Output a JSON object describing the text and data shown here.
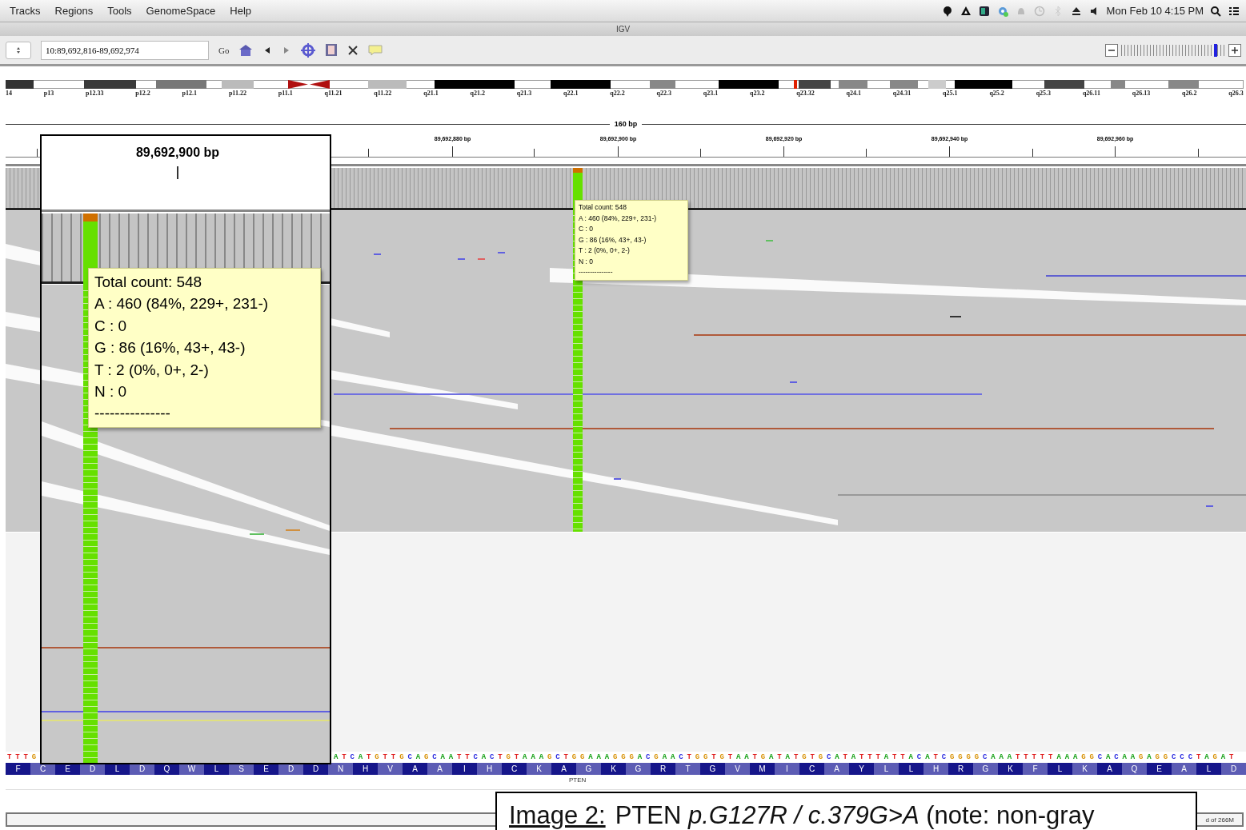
{
  "menu_bar": {
    "menus": [
      "Tracks",
      "Regions",
      "Tools",
      "GenomeSpace",
      "Help"
    ],
    "clock": "Mon Feb 10  4:15 PM"
  },
  "window": {
    "title": "IGV"
  },
  "toolbar": {
    "locus": "10:89,692,816-89,692,974",
    "go_button": "Go",
    "zoom": {
      "level": 0.92
    }
  },
  "ideogram": {
    "bands": [
      "14",
      "p13",
      "p12.33",
      "p12.2",
      "p12.1",
      "p11.22",
      "p11.1",
      "q11.21",
      "q11.22",
      "q21.1",
      "q21.2",
      "q21.3",
      "q22.1",
      "q22.2",
      "q22.3",
      "q23.1",
      "q23.2",
      "q23.32",
      "q24.1",
      "q24.31",
      "q25.1",
      "q25.2",
      "q25.3",
      "q26.11",
      "q26.13",
      "q26.2",
      "q26.3"
    ]
  },
  "ruler": {
    "span": "160 bp",
    "ticks": [
      "89,692,880 bp",
      "89,692,900 bp",
      "89,692,920 bp",
      "89,692,940 bp",
      "89,692,960 bp"
    ]
  },
  "popup": {
    "lines": [
      "Total count: 548",
      "A : 460 (84%, 229+, 231-)",
      "C : 0",
      "G : 86 (16%, 43+, 43-)",
      "T : 2 (0%, 0+, 2-)",
      "N : 0",
      "---------------"
    ]
  },
  "inset": {
    "position": "89,692,900 bp",
    "popup": {
      "lines": [
        "Total count: 548",
        "A : 460 (84%, 229+, 231-)",
        "C : 0",
        "G : 86 (16%, 43+, 43-)",
        "T : 2 (0%, 0+, 2-)",
        "N : 0",
        "---------------"
      ]
    }
  },
  "sequence": [
    "TTTG",
    "ATCATGTTGCAGCAATTCACTGTAAAGCTGGAAAGGGACGAACTGGTGTAATGATATGTGCATATTTATTACATCGGGGCAAATTTTTAAAGGCACAAGAGGCCCTAGAT"
  ],
  "amino_acids": "F C E D L D Q W L S E D D N H V A A I H C K A G K G R T G V M I C A Y L L H R G K F L K A Q E A L D",
  "gene": "PTEN",
  "caption": {
    "label": "Image 2:",
    "text": "PTEN *p.G127R / c.379G>A* (note: non-gray"
  },
  "status_bar": {
    "memory": "d of 266M"
  }
}
